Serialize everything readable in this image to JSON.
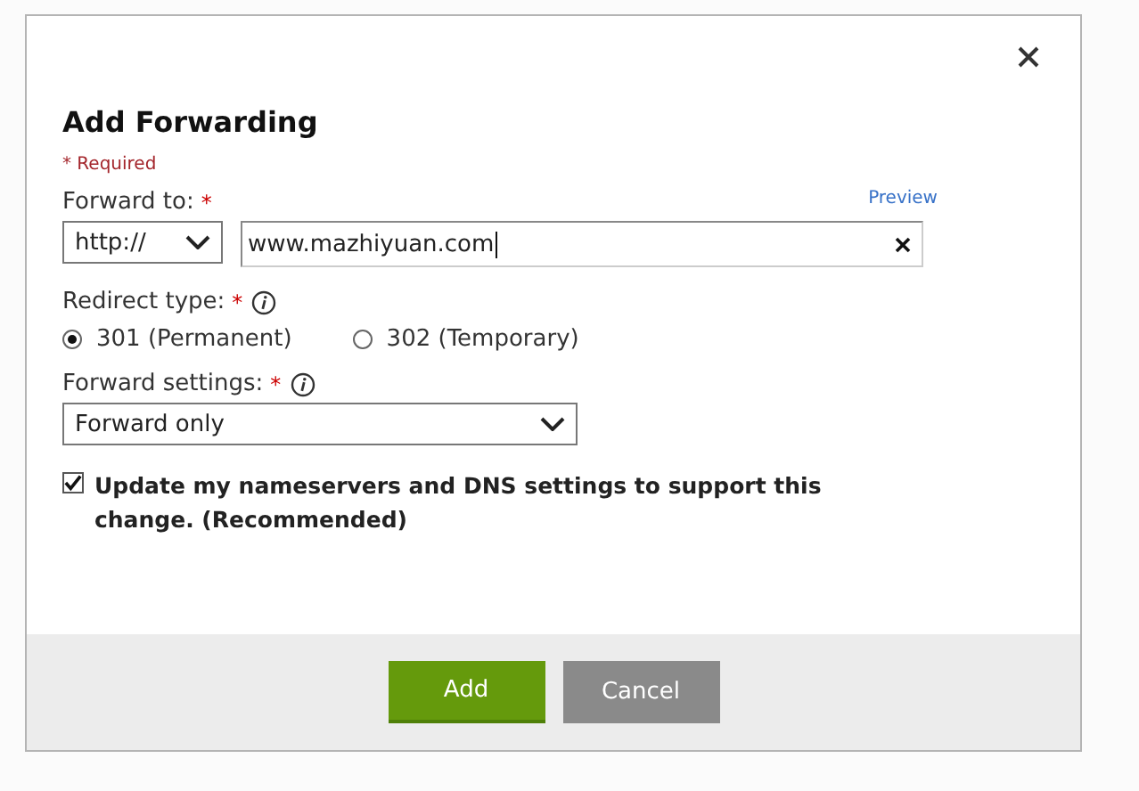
{
  "dialog": {
    "title": "Add Forwarding",
    "required_note": "* Required",
    "forward_to": {
      "label": "Forward to:",
      "required_mark": "*",
      "preview_link": "Preview",
      "protocol": "http://",
      "url": "www.mazhiyuan.com"
    },
    "redirect_type": {
      "label": "Redirect type:",
      "required_mark": "*",
      "options": [
        {
          "label": "301 (Permanent)",
          "selected": true
        },
        {
          "label": "302 (Temporary)",
          "selected": false
        }
      ]
    },
    "forward_settings": {
      "label": "Forward settings:",
      "required_mark": "*",
      "value": "Forward only"
    },
    "update_dns": {
      "label": "Update my nameservers and DNS settings to support this change. (Recommended)",
      "checked": true
    },
    "buttons": [
      {
        "label": "Add",
        "kind": "primary"
      },
      {
        "label": "Cancel",
        "kind": "secondary"
      }
    ]
  }
}
